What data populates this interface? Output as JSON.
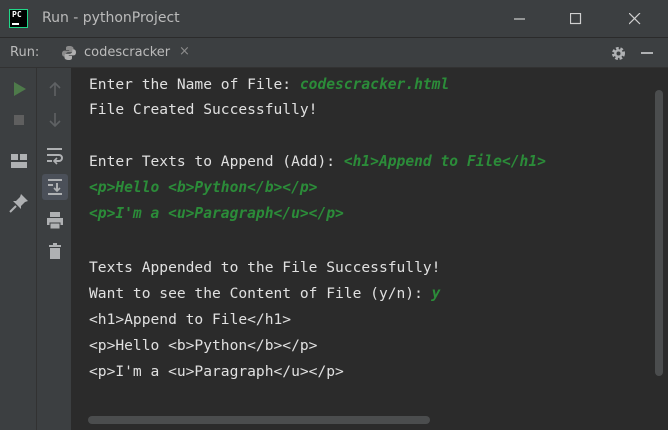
{
  "window": {
    "title": "Run - pythonProject",
    "logo_text": "PC"
  },
  "run_bar": {
    "label": "Run:",
    "tab_label": "codescracker",
    "tab_close": "×"
  },
  "console": {
    "lines": [
      {
        "prompt": "Enter the Name of File: ",
        "input": "codescracker.html"
      },
      {
        "prompt": "File Created Successfully!",
        "input": ""
      },
      {
        "prompt": "",
        "input": ""
      },
      {
        "prompt": "Enter Texts to Append (Add): ",
        "input": "<h1>Append to File</h1>"
      },
      {
        "prompt": "",
        "input": "<p>Hello <b>Python</b></p>"
      },
      {
        "prompt": "",
        "input": "<p>I'm a <u>Paragraph</u></p>"
      },
      {
        "prompt": "",
        "input": ""
      },
      {
        "prompt": "Texts Appended to the File Successfully!",
        "input": ""
      },
      {
        "prompt": "Want to see the Content of File (y/n): ",
        "input": "y"
      },
      {
        "prompt": "<h1>Append to File</h1>",
        "input": ""
      },
      {
        "prompt": "<p>Hello <b>Python</b></p>",
        "input": ""
      },
      {
        "prompt": "<p>I'm a <u>Paragraph</u></p>",
        "input": ""
      }
    ]
  },
  "colors": {
    "background": "#2b2b2b",
    "panel": "#3c3f41",
    "text": "#e0e0e0",
    "user_input": "#2c9e3c"
  },
  "icons": [
    "run-icon",
    "stop-icon",
    "layout-icon",
    "pin-icon",
    "up-arrow-icon",
    "down-arrow-icon",
    "soft-wrap-icon",
    "scroll-to-end-icon",
    "print-icon",
    "trash-icon",
    "gear-icon",
    "minimize-icon",
    "python-icon"
  ]
}
